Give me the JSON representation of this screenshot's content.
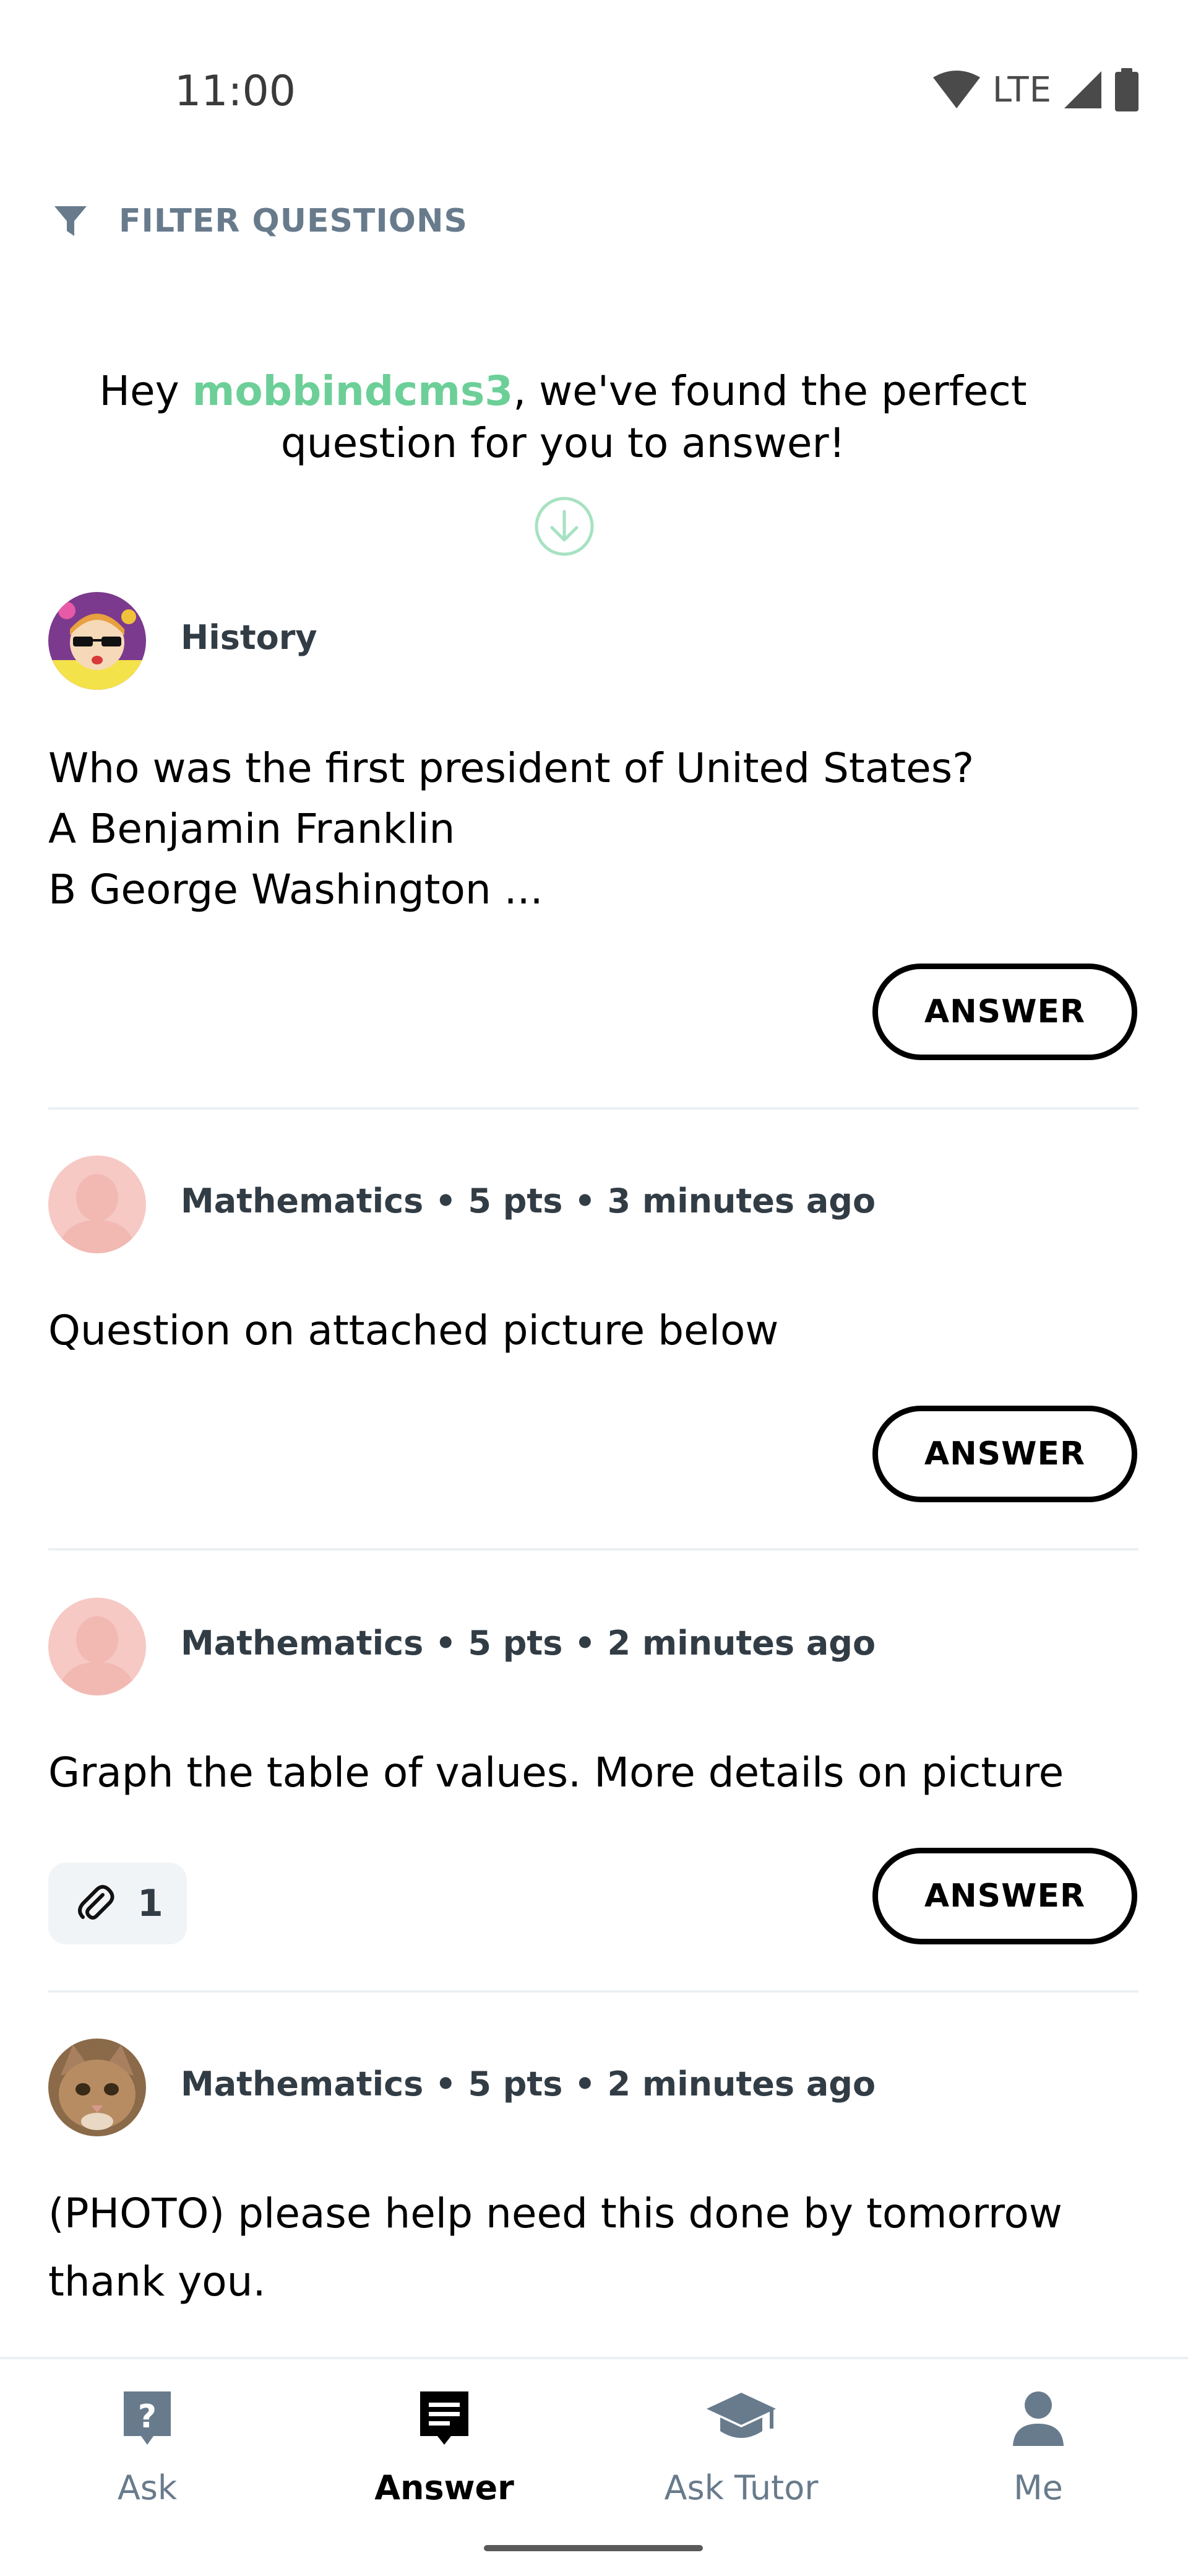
{
  "status_bar": {
    "time": "11:00",
    "network": "LTE"
  },
  "filter": {
    "label": "FILTER QUESTIONS"
  },
  "intro": {
    "prefix": "Hey ",
    "username": "mobbindcms3",
    "suffix": ", we've found the perfect question for you to answer!"
  },
  "questions": [
    {
      "meta": "History",
      "lines": [
        "Who was the first president of United States?",
        "A Benjamin Franklin",
        "B George Washington ..."
      ],
      "answer_label": "ANSWER"
    },
    {
      "meta": "Mathematics • 5 pts • 3 minutes ago",
      "lines": [
        "Question on attached picture below"
      ],
      "answer_label": "ANSWER"
    },
    {
      "meta": "Mathematics • 5 pts • 2 minutes ago",
      "lines": [
        "Graph the table of values. More details on picture"
      ],
      "attachments": "1",
      "answer_label": "ANSWER"
    },
    {
      "meta": "Mathematics • 5 pts • 2 minutes ago",
      "lines": [
        "(PHOTO) please help need this done by tomorrow",
        "thank you."
      ]
    }
  ],
  "nav": {
    "items": [
      {
        "label": "Ask",
        "icon": "question-icon",
        "active": false
      },
      {
        "label": "Answer",
        "icon": "answer-icon",
        "active": true
      },
      {
        "label": "Ask Tutor",
        "icon": "graduation-cap-icon",
        "active": false
      },
      {
        "label": "Me",
        "icon": "person-icon",
        "active": false
      }
    ]
  },
  "colors": {
    "accent_green": "#6ccf98",
    "muted_text": "#687b8c",
    "meta_text": "#323c45",
    "default_avatar": "#f6c9c4"
  }
}
